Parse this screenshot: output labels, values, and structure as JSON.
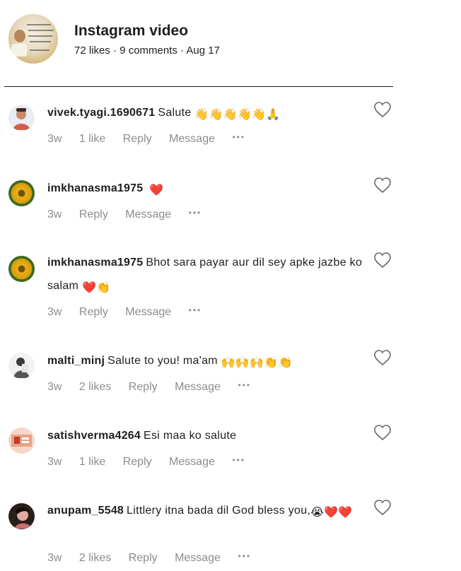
{
  "post": {
    "title": "Instagram video",
    "meta": "72 likes · 9 comments · Aug 17"
  },
  "comments": [
    {
      "user": "vivek.tyagi.1690671",
      "text": "Salute",
      "emoji": "👋👋👋👋👋🙏",
      "time": "3w",
      "likes": "1 like",
      "reply": "Reply",
      "message": "Message",
      "more": "•••"
    },
    {
      "user": "imkhanasma1975",
      "text": "",
      "emoji": "❤️",
      "time": "3w",
      "likes": "",
      "reply": "Reply",
      "message": "Message",
      "more": "•••"
    },
    {
      "user": "imkhanasma1975",
      "text": "Bhot sara payar aur dil sey apke jazbe ko salam",
      "emoji": "❤️👏",
      "time": "3w",
      "likes": "",
      "reply": "Reply",
      "message": "Message",
      "more": "•••"
    },
    {
      "user": "malti_minj",
      "text": "Salute to you! ma'am",
      "emoji": "🙌🙌🙌👏👏",
      "time": "3w",
      "likes": "2 likes",
      "reply": "Reply",
      "message": "Message",
      "more": "•••"
    },
    {
      "user": "satishverma4264",
      "text": "Esi maa ko salute",
      "emoji": "",
      "time": "3w",
      "likes": "1 like",
      "reply": "Reply",
      "message": "Message",
      "more": "•••"
    },
    {
      "user": "anupam_5548",
      "text": "Littlery itna bada dil God bless you,",
      "emoji": "😭❤️❤️",
      "time": "3w",
      "likes": "2 likes",
      "reply": "Reply",
      "message": "Message",
      "more": "•••"
    }
  ],
  "icons": {
    "like": "heart-outline-icon",
    "more": "more-dots-icon"
  },
  "colors": {
    "text": "#1c1e21",
    "muted": "#8a8d91",
    "heart_outline": "#65676b"
  }
}
